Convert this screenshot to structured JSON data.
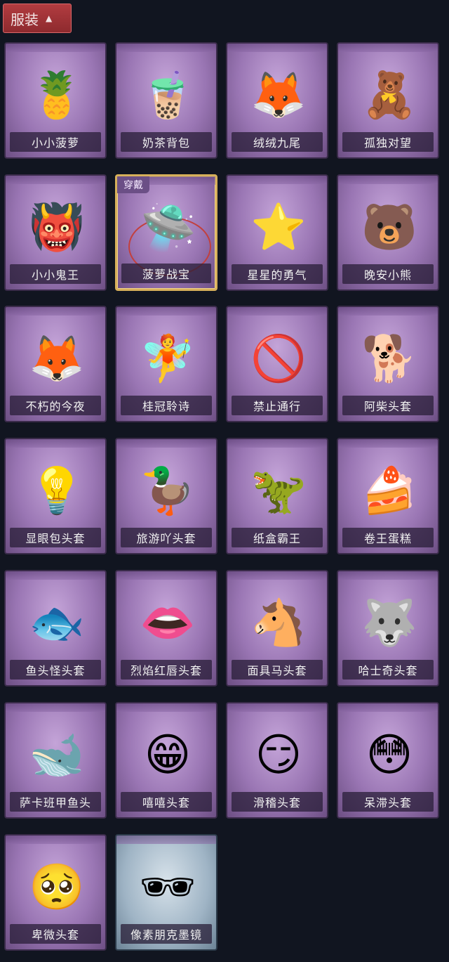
{
  "header": {
    "label": "服装",
    "chevron": "chevron-up-icon"
  },
  "badge": "穿戴",
  "items": [
    {
      "label": "小小菠萝",
      "icon": "pineapple-character-icon"
    },
    {
      "label": "奶茶背包",
      "icon": "milk-tea-backpack-icon"
    },
    {
      "label": "绒绒九尾",
      "icon": "nine-tail-fox-icon"
    },
    {
      "label": "孤独对望",
      "icon": "lonely-gaze-pendant-icon"
    },
    {
      "label": "小小鬼王",
      "icon": "little-ghost-king-icon"
    },
    {
      "label": "菠萝战宝",
      "icon": "pineapple-battle-pendant-icon"
    },
    {
      "label": "星星的勇气",
      "icon": "star-courage-pendant-icon"
    },
    {
      "label": "晚安小熊",
      "icon": "good-night-bear-icon"
    },
    {
      "label": "不朽的今夜",
      "icon": "immortal-tonight-fox-icon"
    },
    {
      "label": "桂冠聆诗",
      "icon": "laurel-poet-pendant-icon"
    },
    {
      "label": "禁止通行",
      "icon": "no-entry-cone-icon"
    },
    {
      "label": "阿柴头套",
      "icon": "shiba-head-icon"
    },
    {
      "label": "显眼包头套",
      "icon": "bulb-head-icon"
    },
    {
      "label": "旅游吖头套",
      "icon": "duck-hat-head-icon"
    },
    {
      "label": "纸盒霸王",
      "icon": "cardboard-dino-icon"
    },
    {
      "label": "卷王蛋糕",
      "icon": "roll-cake-head-icon"
    },
    {
      "label": "鱼头怪头套",
      "icon": "fish-head-icon"
    },
    {
      "label": "烈焰红唇头套",
      "icon": "red-lips-head-icon"
    },
    {
      "label": "面具马头套",
      "icon": "horse-mask-head-icon"
    },
    {
      "label": "哈士奇头套",
      "icon": "husky-head-icon"
    },
    {
      "label": "萨卡班甲鱼头",
      "icon": "sacabambaspis-head-icon"
    },
    {
      "label": "嘻嘻头套",
      "icon": "grin-emoji-head-icon"
    },
    {
      "label": "滑稽头套",
      "icon": "sly-emoji-head-icon"
    },
    {
      "label": "呆滞头套",
      "icon": "dazed-emoji-head-icon"
    },
    {
      "label": "卑微头套",
      "icon": "humble-emoji-head-icon"
    },
    {
      "label": "像素朋克墨镜",
      "icon": "pixel-sunglasses-icon"
    }
  ],
  "selected_index": 5
}
